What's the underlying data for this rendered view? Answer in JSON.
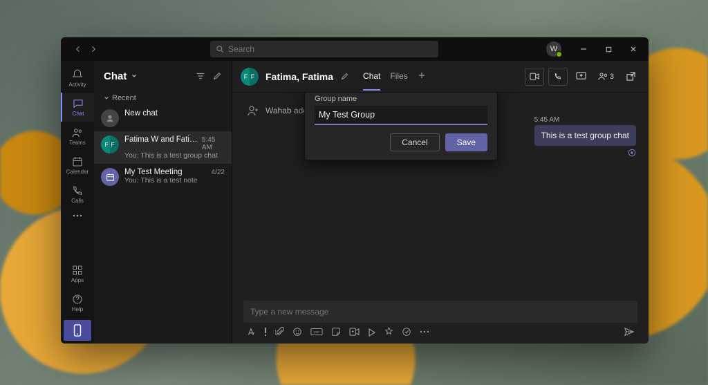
{
  "search": {
    "placeholder": "Search"
  },
  "user_avatar_initial": "W",
  "sidebar": {
    "items": [
      {
        "label": "Activity"
      },
      {
        "label": "Chat"
      },
      {
        "label": "Teams"
      },
      {
        "label": "Calendar"
      },
      {
        "label": "Calls"
      }
    ],
    "apps_label": "Apps",
    "help_label": "Help"
  },
  "chat_list": {
    "title": "Chat",
    "section": "Recent",
    "items": [
      {
        "title": "New chat",
        "subtitle": "",
        "time": ""
      },
      {
        "title": "Fatima W and Fatima W",
        "subtitle": "You: This is a test group chat",
        "time": "5:45 AM"
      },
      {
        "title": "My Test Meeting",
        "subtitle": "You: This is a test note",
        "time": "4/22"
      }
    ]
  },
  "conversation": {
    "title": "Fatima, Fatima",
    "tabs": {
      "chat": "Chat",
      "files": "Files"
    },
    "participant_count": "3",
    "system_message": "Wahab added",
    "dialog": {
      "label": "Group name",
      "value": "My Test Group",
      "cancel": "Cancel",
      "save": "Save"
    },
    "message": {
      "time": "5:45 AM",
      "text": "This is a test group chat"
    },
    "composer_placeholder": "Type a new message"
  }
}
